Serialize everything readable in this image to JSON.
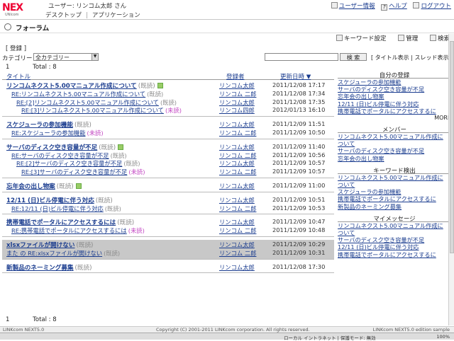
{
  "header": {
    "logo_text": "NEX",
    "logo_sub": "UNIcom",
    "user_line": "ユーザー: リンコム太郎 さん",
    "nav": [
      "デスクトップ",
      "アプリケーション"
    ],
    "links": [
      "ユーザー情報",
      "ヘルプ",
      "ログアウト"
    ]
  },
  "page_title": "フォーラム",
  "toolbar": [
    "キーワード設定",
    "管理",
    "検索"
  ],
  "register_label": "[ 登録 ]",
  "filter": {
    "category_label": "カテゴリー",
    "category_value": "全カテゴリー",
    "search_placeholder": "",
    "search_button": "検 索",
    "view_links": "[ タイトル表示 | スレッド表示 ]"
  },
  "pager": {
    "page": "1",
    "total": "Total : 8"
  },
  "table": {
    "headers": [
      "タイトル",
      "登録者",
      "更新日時 ▼"
    ],
    "threads": [
      {
        "rows": [
          {
            "title": "リンコムネクスト5.00マニュアル作成について",
            "badge": "(既読)",
            "flag": true,
            "indent": 0,
            "author": "リンコム太郎",
            "date": "2011/12/08 17:17"
          },
          {
            "title": "RE:リンコムネクスト5.00マニュアル作成について",
            "badge": "(既読)",
            "indent": 1,
            "author": "リンコム 二郎",
            "date": "2011/12/08 17:34"
          },
          {
            "title": "RE:[2]リンコムネクスト5.00マニュアル作成について",
            "badge": "(既読)",
            "indent": 2,
            "author": "リンコム太郎",
            "date": "2011/12/08 17:35"
          },
          {
            "title": "RE:[3]リンコムネクスト5.00マニュアル作成について",
            "badge": "(未読)",
            "unread": true,
            "indent": 3,
            "author": "リンコム四郎",
            "date": "2012/01/13 16:10"
          }
        ]
      },
      {
        "rows": [
          {
            "title": "スケジューラの参加機能",
            "badge": "(既読)",
            "indent": 0,
            "author": "リンコム太郎",
            "date": "2011/12/09 11:51"
          },
          {
            "title": "RE:スケジューラの参加機能",
            "badge": "(未読)",
            "unread": true,
            "indent": 1,
            "author": "リンコム 二郎",
            "date": "2011/12/09 10:50"
          }
        ]
      },
      {
        "rows": [
          {
            "title": "サーバのディスク空き容量が不足",
            "badge": "(既読)",
            "flag": true,
            "indent": 0,
            "author": "リンコム太郎",
            "date": "2011/12/09 11:40"
          },
          {
            "title": "RE:サーバのディスク空き容量が不足",
            "badge": "(既読)",
            "indent": 1,
            "author": "リンコム 二郎",
            "date": "2011/12/09 10:56"
          },
          {
            "title": "RE:[2]サーバのディスク空き容量が不足",
            "badge": "(既読)",
            "indent": 2,
            "author": "リンコム太郎",
            "date": "2011/12/09 10:57"
          },
          {
            "title": "RE:[3]サーバのディスク空き容量が不足",
            "badge": "(未読)",
            "unread": true,
            "indent": 3,
            "author": "リンコム 二郎",
            "date": "2011/12/09 10:57"
          }
        ]
      },
      {
        "rows": [
          {
            "title": "忘年会の出し物案",
            "badge": "(既読)",
            "flag": true,
            "indent": 0,
            "author": "リンコム太郎",
            "date": "2011/12/09 11:00"
          }
        ]
      },
      {
        "rows": [
          {
            "title": "12/11 (日)ビル停電に伴う対応",
            "badge": "(既読)",
            "indent": 0,
            "author": "リンコム太郎",
            "date": "2011/12/09 10:51"
          },
          {
            "title": "RE:12/11 (日)ビル停電に伴う対応",
            "badge": "(既読)",
            "indent": 1,
            "author": "リンコム 二郎",
            "date": "2011/12/09 10:53"
          }
        ]
      },
      {
        "rows": [
          {
            "title": "携帯電話でポータルにアクセスするには",
            "badge": "(既読)",
            "indent": 0,
            "author": "リンコム太郎",
            "date": "2011/12/09 10:47"
          },
          {
            "title": "RE:携帯電話でポータルにアクセスするには",
            "badge": "(未読)",
            "unread": true,
            "indent": 1,
            "author": "リンコム 二郎",
            "date": "2011/12/09 10:48"
          }
        ]
      },
      {
        "highlight": true,
        "rows": [
          {
            "title": "xlsxファイルが開けない",
            "badge": "(既読)",
            "indent": 0,
            "author": "リンコム太郎",
            "date": "2011/12/09 10:29"
          },
          {
            "title": "また の RE:xlsxファイルが開けない",
            "badge": "(既読)",
            "indent": 0,
            "author": "リンコム 二郎",
            "date": "2011/12/09 10:31"
          }
        ]
      },
      {
        "rows": [
          {
            "title": "新製品のネーミング募集",
            "badge": "(既読)",
            "indent": 0,
            "author": "リンコム太郎",
            "date": "2011/12/08 17:30"
          }
        ]
      }
    ]
  },
  "sidebar": [
    {
      "title": "自分の登録",
      "items": [
        "スケジューラの参加機能",
        "サーバのディスク空き容量が不足",
        "忘年会の出し物案",
        "12/11 (日)ビル停電に伴う対応",
        "携帯電話でポータルにアクセスするに"
      ],
      "more": "MORE"
    },
    {
      "title": "メンバー",
      "items": [
        "リンコムネクスト5.00マニュアル作成に",
        "ついて",
        "サーバのディスク空き容量が不足",
        "忘年会の出し物案"
      ]
    },
    {
      "title": "キーワード検出",
      "items": [
        "リンコムネクスト5.00マニュアル作成に",
        "ついて",
        "スケジューラの参加機能",
        "携帯電話でポータルにアクセスするに",
        "新製品のネーミング募集"
      ]
    },
    {
      "title": "マイメッセージ",
      "items": [
        "リンコムネクスト5.00マニュアル作成に",
        "ついて",
        "サーバのディスク空き容量が不足",
        "12/11 (日)ビル停電に伴う対応",
        "携帯電話でポータルにアクセスするに"
      ]
    }
  ],
  "status": {
    "left": "LINKcom NEXT5.0",
    "center": "Copyright (C) 2001-2011 LINKcom corporation. All rights reserved.",
    "right": "LINKcom NEXT5.0 edition sample"
  },
  "iebar": {
    "zone": "ローカル イントラネット | 保護モード: 無効",
    "zoom": "100%"
  }
}
